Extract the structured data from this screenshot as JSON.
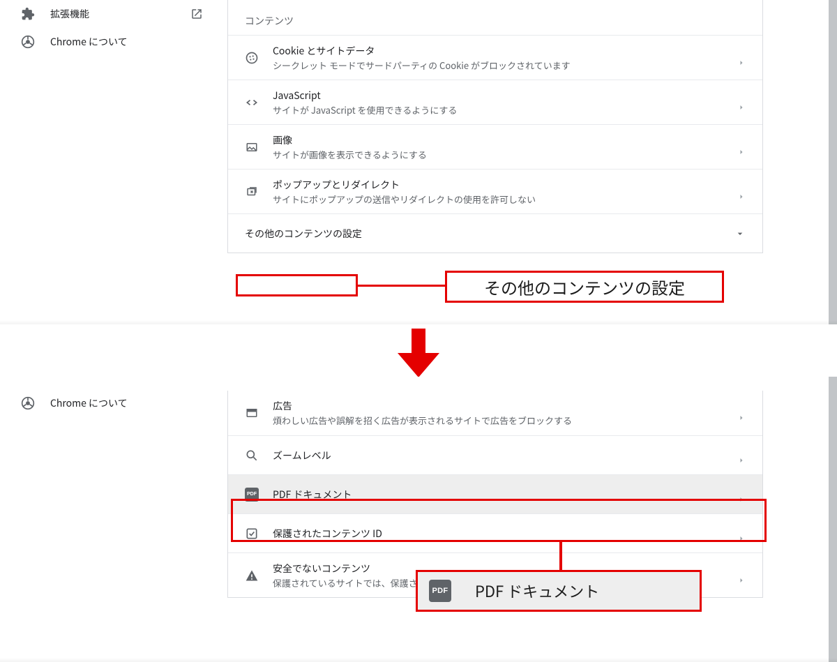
{
  "sidebar": {
    "extensions": "拡張機能",
    "about": "Chrome について"
  },
  "sections": {
    "content_heading": "コンテンツ",
    "other_content_settings": "その他のコンテンツの設定"
  },
  "settings_top": {
    "cookies": {
      "title": "Cookie とサイトデータ",
      "desc": "シークレット モードでサードパーティの Cookie がブロックされています"
    },
    "javascript": {
      "title": "JavaScript",
      "desc": "サイトが JavaScript を使用できるようにする"
    },
    "images": {
      "title": "画像",
      "desc": "サイトが画像を表示できるようにする"
    },
    "popups": {
      "title": "ポップアップとリダイレクト",
      "desc": "サイトにポップアップの送信やリダイレクトの使用を許可しない"
    }
  },
  "settings_bottom": {
    "ads": {
      "title": "広告",
      "desc": "煩わしい広告や誤解を招く広告が表示されるサイトで広告をブロックする"
    },
    "zoom": {
      "title": "ズームレベル"
    },
    "pdf": {
      "title": "PDF ドキュメント"
    },
    "protected": {
      "title": "保護されたコンテンツ ID"
    },
    "insecure": {
      "title": "安全でないコンテンツ",
      "desc": "保護されているサイトでは、保護されていないコンテンツはデフォルトでブロックされます。"
    }
  },
  "annotations": {
    "other_label": "その他のコンテンツの設定",
    "pdf_label": "PDF ドキュメント",
    "pdf_badge": "PDF"
  }
}
